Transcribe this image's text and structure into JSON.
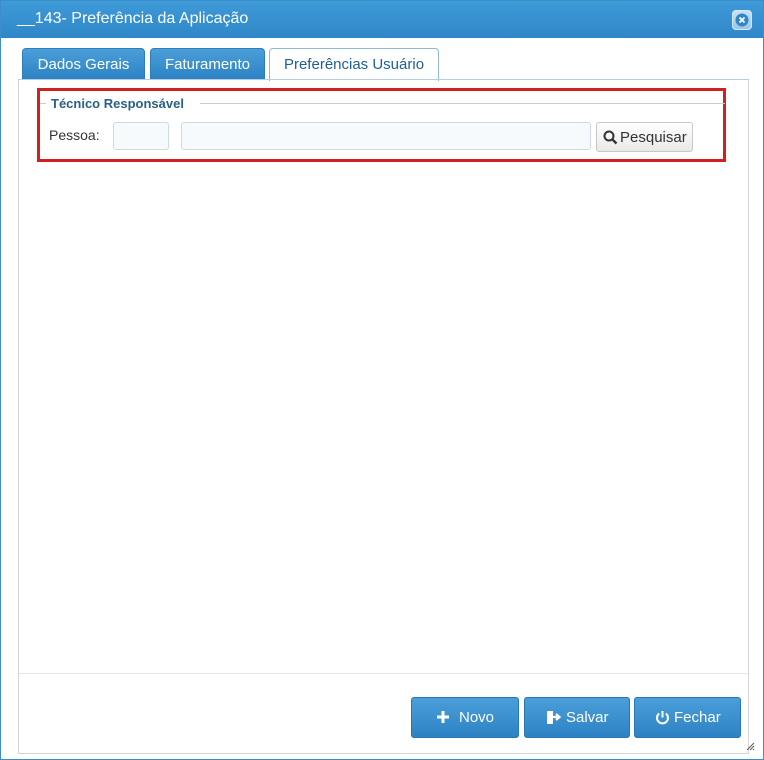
{
  "window": {
    "title": "__143- Preferência da Aplicação",
    "close_icon": "close-icon"
  },
  "tabs": [
    {
      "label": "Dados Gerais"
    },
    {
      "label": "Faturamento"
    },
    {
      "label": "Preferências Usuário"
    }
  ],
  "group": {
    "legend": "Técnico Responsável",
    "person_label": "Pessoa:",
    "code_value": "",
    "name_value": "",
    "search_label": "Pesquisar"
  },
  "footer": {
    "new_label": "Novo",
    "save_label": "Salvar",
    "close_label": "Fechar"
  },
  "colors": {
    "accent": "#2f87c8",
    "highlight": "#d21f1f"
  }
}
